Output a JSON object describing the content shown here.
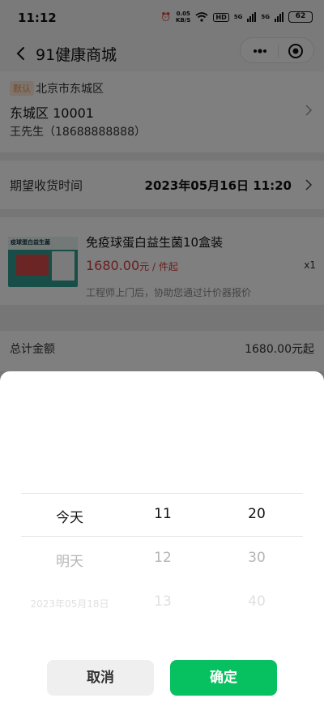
{
  "status_bar": {
    "time": "11:12",
    "net_speed_value": "0.05",
    "net_speed_unit": "KB/S",
    "hd": "HD",
    "net1": "5G",
    "net2": "5G",
    "battery": "62"
  },
  "nav": {
    "title": "91健康商城"
  },
  "address": {
    "tag": "默认",
    "city": "北京市东城区",
    "street": "东城区 10001",
    "contact": "王先生（18688888888）"
  },
  "delivery": {
    "label": "期望收货时间",
    "value": "2023年05月16日 11:20"
  },
  "product": {
    "name": "免疫球蛋白益生菌10盒装",
    "price": "1680.00",
    "price_unit": "元 / 件起",
    "qty": "x1",
    "note": "工程师上门后，协助您通过计价器报价",
    "image_caption": "疫球蛋白益生菌"
  },
  "summary": {
    "label": "总计金额",
    "value": "1680.00元起"
  },
  "picker": {
    "day": [
      "今天",
      "明天",
      "2023年05月18日"
    ],
    "hour": [
      "11",
      "12",
      "13"
    ],
    "minute": [
      "20",
      "30",
      "40"
    ],
    "cancel": "取消",
    "confirm": "确定"
  },
  "colors": {
    "accent": "#07c160",
    "price": "#d63c3c",
    "tag_bg": "#fde9d7",
    "tag_text": "#e8914a"
  }
}
